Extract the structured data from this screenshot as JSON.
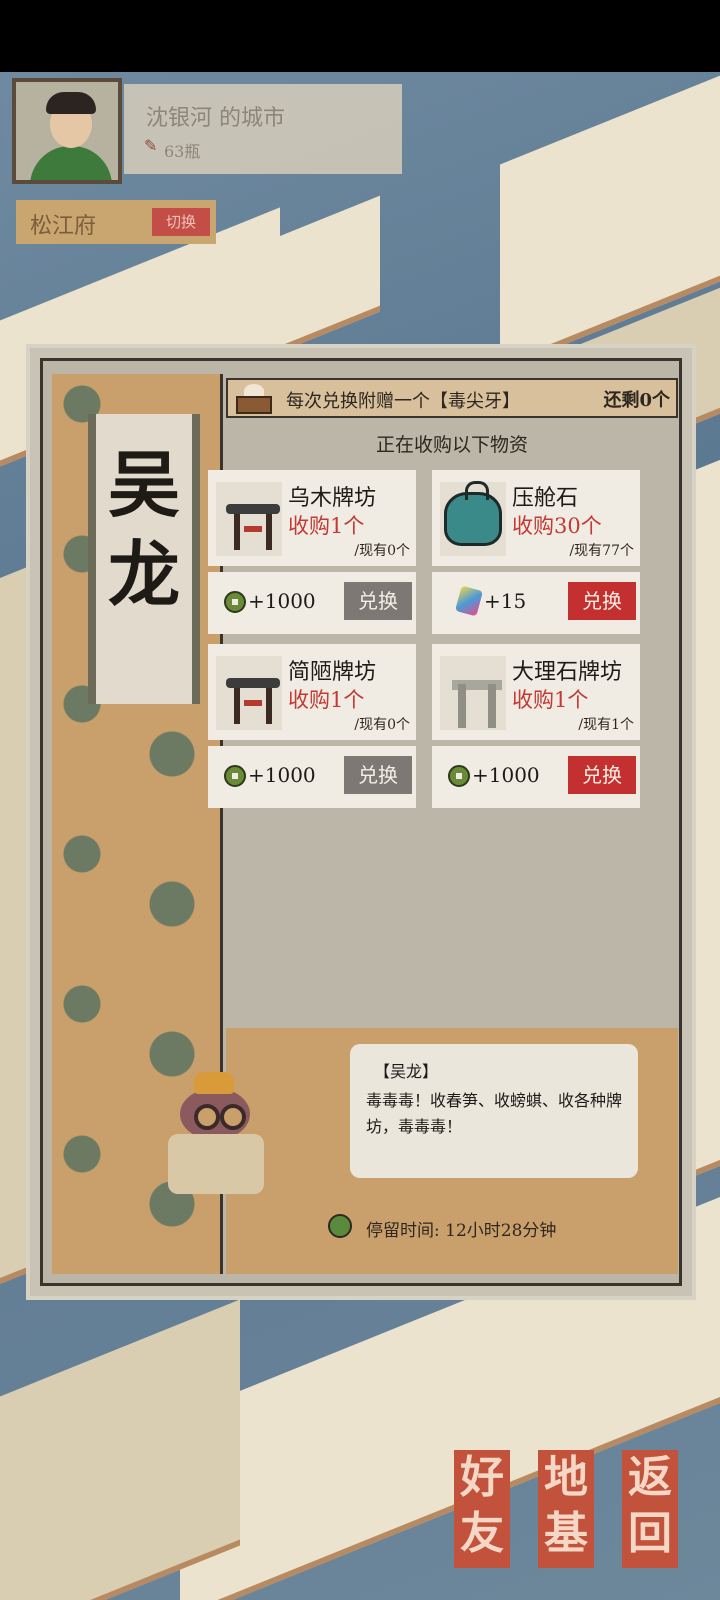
{
  "player": {
    "city_name": "沈银河 的城市",
    "count": "63瓶",
    "region": "松江府",
    "switch_label": "切换"
  },
  "merchant": {
    "name": "吴龙",
    "bonus_text": "每次兑换附赠一个【毒尖牙】",
    "remaining": "还剩0个",
    "subtitle": "正在收购以下物资",
    "items": [
      {
        "name": "乌木牌坊",
        "need": "收购1个",
        "have": "/现有0个",
        "reward": "+1000",
        "reward_icon": "copper-coin-icon",
        "button": "兑换",
        "button_state": "disabled"
      },
      {
        "name": "压舱石",
        "need": "收购30个",
        "have": "/现有77个",
        "reward": "+15",
        "reward_icon": "gem-icon",
        "button": "兑换",
        "button_state": "enabled"
      },
      {
        "name": "简陋牌坊",
        "need": "收购1个",
        "have": "/现有0个",
        "reward": "+1000",
        "reward_icon": "copper-coin-icon",
        "button": "兑换",
        "button_state": "disabled"
      },
      {
        "name": "大理石牌坊",
        "need": "收购1个",
        "have": "/现有1个",
        "reward": "+1000",
        "reward_icon": "copper-coin-icon",
        "button": "兑换",
        "button_state": "enabled"
      }
    ],
    "speech_name": "【吴龙】",
    "speech_text": "毒毒毒！收春笋、收螃蜞、收各种牌坊，毒毒毒！",
    "stay_label": "停留时间:",
    "stay_time": "12小时28分钟"
  },
  "nav": {
    "friends": "好友",
    "base": "地基",
    "back": "返回"
  },
  "colors": {
    "accent_red": "#c4302f",
    "disabled_gray": "#7c7873",
    "panel_bg": "#bcb6a8"
  }
}
